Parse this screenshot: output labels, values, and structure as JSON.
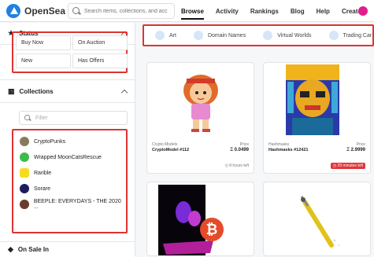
{
  "brand": {
    "name": "OpenSea"
  },
  "search": {
    "placeholder": "Search items, collections, and acc"
  },
  "nav": {
    "items": [
      "Browse",
      "Activity",
      "Rankings",
      "Blog",
      "Help",
      "Create"
    ]
  },
  "sidebar": {
    "status": {
      "title": "Status",
      "buttons": [
        "Buy Now",
        "On Auction",
        "New",
        "Has Offers"
      ]
    },
    "collections": {
      "title": "Collections",
      "filter_placeholder": "Filter",
      "items": [
        "CryptoPunks",
        "Wrapped MoonCatsRescue",
        "Rarible",
        "Sorare",
        "BEEPLE: EVERYDAYS - THE 2020 ..."
      ]
    },
    "on_sale": {
      "title": "On Sale In"
    }
  },
  "categories": [
    "Art",
    "Domain Names",
    "Virtual Worlds",
    "Trading Car"
  ],
  "cards": [
    {
      "collection": "Crypto Models",
      "name": "CryptoModel #112",
      "price_label": "Price",
      "price": "Ξ 0.0499",
      "time": "8 hours left",
      "urgent": false
    },
    {
      "collection": "Hashmasks",
      "name": "Hashmasks #12421",
      "price_label": "Price",
      "price": "Ξ 2.9999",
      "time": "29 minutes left",
      "urgent": true
    }
  ],
  "colors": {
    "accent": "#2081e2",
    "highlight": "#dd3333",
    "urgent": "#e0353b"
  }
}
